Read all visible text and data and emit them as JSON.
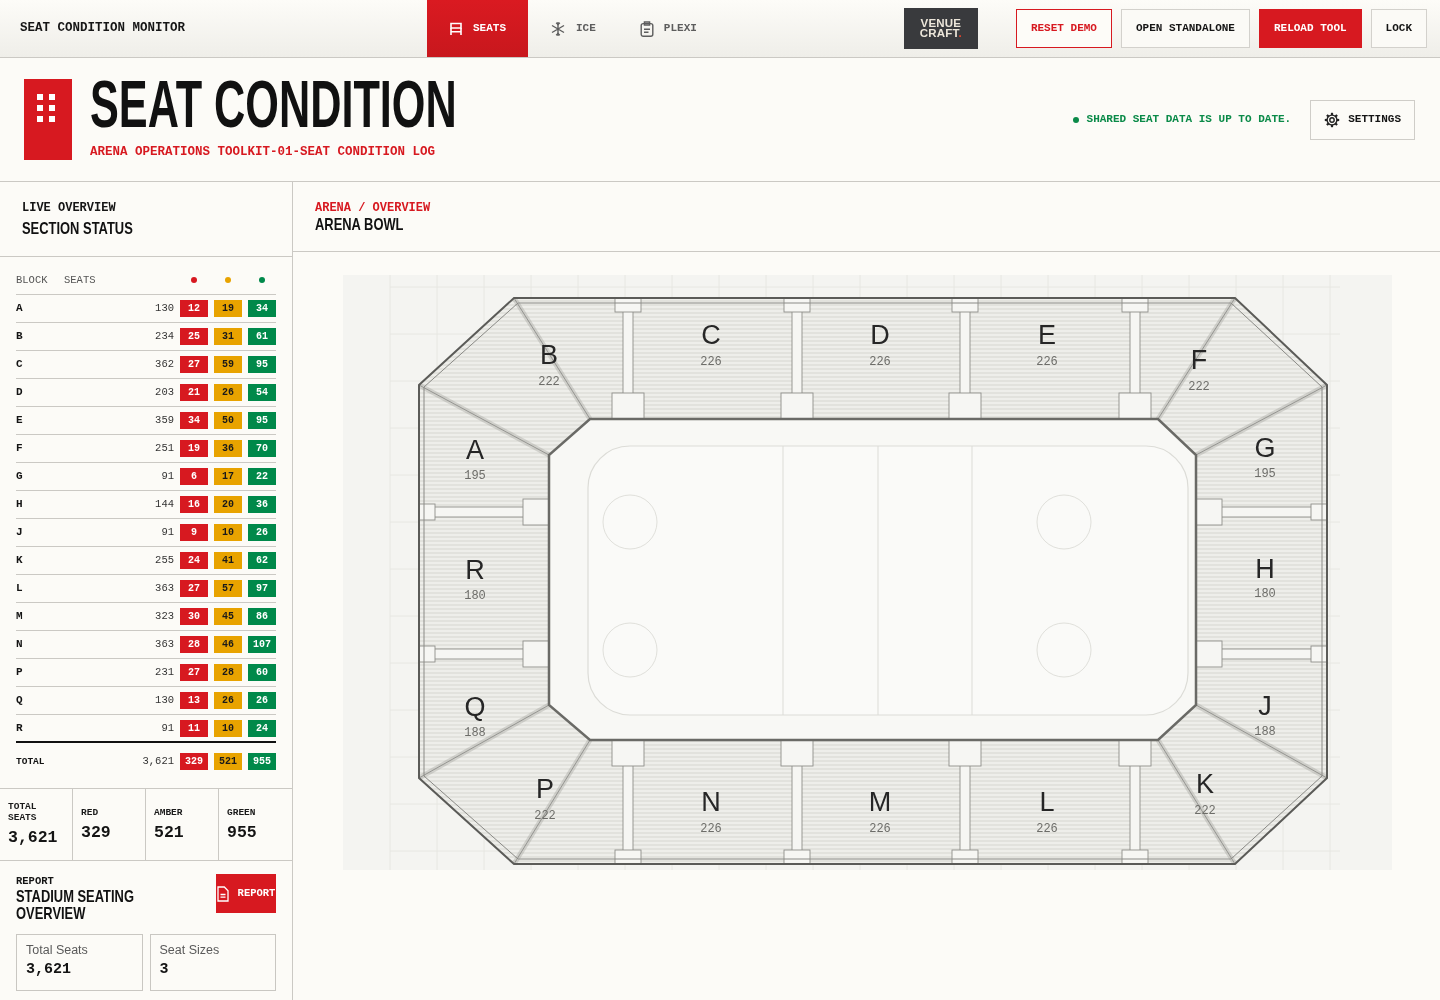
{
  "top_bar": {
    "title": "SEAT CONDITION MONITOR",
    "tabs": [
      {
        "label": "SEATS",
        "selected": true
      },
      {
        "label": "ICE",
        "selected": false
      },
      {
        "label": "PLEXI",
        "selected": false
      }
    ],
    "logo": {
      "lines": [
        "VENUE",
        "CRAFT"
      ],
      "accent": "."
    },
    "actions": [
      {
        "label": "RESET DEMO",
        "kind": "outline"
      },
      {
        "label": "OPEN STANDALONE",
        "kind": "plain"
      },
      {
        "label": "RELOAD TOOL",
        "kind": "solid"
      },
      {
        "label": "LOCK",
        "kind": "plain"
      }
    ]
  },
  "header": {
    "title": "SEAT CONDITION",
    "subtitle": "ARENA OPERATIONS TOOLKIT-01-SEAT CONDITION LOG",
    "sync_status": {
      "text": "SHARED SEAT DATA IS UP TO DATE.",
      "ok": true
    },
    "settings_button": "SETTINGS"
  },
  "sidebar": {
    "eyebrow": "LIVE OVERVIEW",
    "title": "SECTION STATUS",
    "table": {
      "columns": [
        "BLOCK",
        "SEATS"
      ],
      "status_columns": [
        {
          "color": "#d71920"
        },
        {
          "color": "#e8a300"
        },
        {
          "color": "#00894a"
        }
      ],
      "rows": [
        {
          "block": "A",
          "seats": "130",
          "counts": [
            "12",
            "19",
            "34"
          ]
        },
        {
          "block": "B",
          "seats": "234",
          "counts": [
            "25",
            "31",
            "61"
          ]
        },
        {
          "block": "C",
          "seats": "362",
          "counts": [
            "27",
            "59",
            "95"
          ]
        },
        {
          "block": "D",
          "seats": "203",
          "counts": [
            "21",
            "26",
            "54"
          ]
        },
        {
          "block": "E",
          "seats": "359",
          "counts": [
            "34",
            "50",
            "95"
          ]
        },
        {
          "block": "F",
          "seats": "251",
          "counts": [
            "19",
            "36",
            "70"
          ]
        },
        {
          "block": "G",
          "seats": "91",
          "counts": [
            "6",
            "17",
            "22"
          ]
        },
        {
          "block": "H",
          "seats": "144",
          "counts": [
            "16",
            "20",
            "36"
          ]
        },
        {
          "block": "J",
          "seats": "91",
          "counts": [
            "9",
            "10",
            "26"
          ]
        },
        {
          "block": "K",
          "seats": "255",
          "counts": [
            "24",
            "41",
            "62"
          ]
        },
        {
          "block": "L",
          "seats": "363",
          "counts": [
            "27",
            "57",
            "97"
          ]
        },
        {
          "block": "M",
          "seats": "323",
          "counts": [
            "30",
            "45",
            "86"
          ]
        },
        {
          "block": "N",
          "seats": "363",
          "counts": [
            "28",
            "46",
            "107"
          ]
        },
        {
          "block": "P",
          "seats": "231",
          "counts": [
            "27",
            "28",
            "60"
          ]
        },
        {
          "block": "Q",
          "seats": "130",
          "counts": [
            "13",
            "26",
            "26"
          ]
        },
        {
          "block": "R",
          "seats": "91",
          "counts": [
            "11",
            "10",
            "24"
          ]
        }
      ],
      "total": {
        "block": "TOTAL",
        "seats": "3,621",
        "counts": [
          "329",
          "521",
          "955"
        ]
      }
    },
    "summary": [
      {
        "label": "TOTAL SEATS",
        "value": "3,621"
      },
      {
        "label": "RED",
        "value": "329"
      },
      {
        "label": "AMBER",
        "value": "521"
      },
      {
        "label": "GREEN",
        "value": "955"
      }
    ],
    "report": {
      "eyebrow": "REPORT",
      "title": "STADIUM SEATING OVERVIEW",
      "button": "REPORT",
      "cards": [
        {
          "label": "Total Seats",
          "value": "3,621"
        },
        {
          "label": "Seat Sizes",
          "value": "3"
        }
      ]
    }
  },
  "main": {
    "breadcrumb": "ARENA / OVERVIEW",
    "title": "ARENA BOWL",
    "map": {
      "sections": [
        {
          "block": "B",
          "seats": "222"
        },
        {
          "block": "C",
          "seats": "226"
        },
        {
          "block": "D",
          "seats": "226"
        },
        {
          "block": "E",
          "seats": "226"
        },
        {
          "block": "F",
          "seats": "222"
        },
        {
          "block": "A",
          "seats": "195"
        },
        {
          "block": "G",
          "seats": "195"
        },
        {
          "block": "R",
          "seats": "180"
        },
        {
          "block": "H",
          "seats": "180"
        },
        {
          "block": "Q",
          "seats": "188"
        },
        {
          "block": "J",
          "seats": "188"
        },
        {
          "block": "P",
          "seats": "222"
        },
        {
          "block": "N",
          "seats": "226"
        },
        {
          "block": "M",
          "seats": "226"
        },
        {
          "block": "L",
          "seats": "226"
        },
        {
          "block": "K",
          "seats": "222"
        }
      ]
    }
  }
}
